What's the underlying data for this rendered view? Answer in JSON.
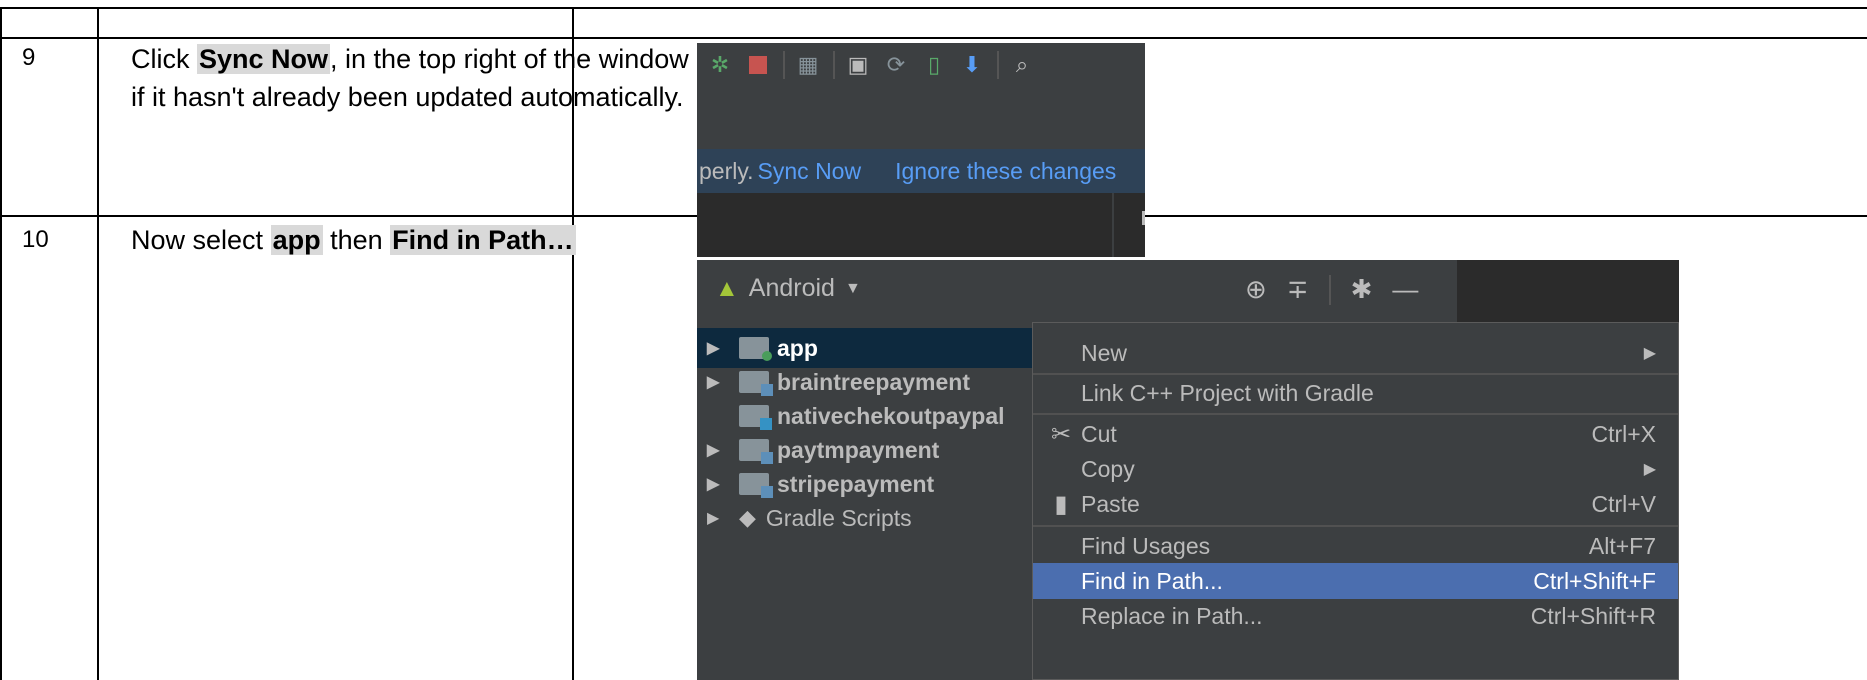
{
  "rows": [
    {
      "step": "9",
      "before": "Click ",
      "highlight": "Sync Now",
      "after": ", in the top right of the window if it hasn't already been updated automatically."
    },
    {
      "step": "10",
      "before": "Now select ",
      "highlight": "app",
      "middle": " then ",
      "highlight2": "Find in Path…"
    }
  ],
  "sync_banner": {
    "prefix": "perly.",
    "sync_now": "Sync Now",
    "ignore": "Ignore these changes"
  },
  "project_panel": {
    "view_label": "Android",
    "tree": [
      {
        "label": "app",
        "selected": true
      },
      {
        "label": "braintreepayment"
      },
      {
        "label": "nativechekoutpaypal"
      },
      {
        "label": "paytmpayment"
      },
      {
        "label": "stripepayment"
      },
      {
        "label": "Gradle Scripts"
      }
    ]
  },
  "context_menu": [
    {
      "label": "New",
      "shortcut": "",
      "submenu": true
    },
    {
      "label": "Link C++ Project with Gradle",
      "shortcut": ""
    },
    {
      "label": "Cut",
      "shortcut": "Ctrl+X",
      "icon": "scissors-icon"
    },
    {
      "label": "Copy",
      "shortcut": "",
      "submenu": true
    },
    {
      "label": "Paste",
      "shortcut": "Ctrl+V",
      "icon": "clipboard-icon"
    },
    {
      "label": "Find Usages",
      "shortcut": "Alt+F7"
    },
    {
      "label": "Find in Path...",
      "shortcut": "Ctrl+Shift+F",
      "highlighted": true
    },
    {
      "label": "Replace in Path...",
      "shortcut": "Ctrl+Shift+R"
    }
  ],
  "colors": {
    "ide_bg": "#3c3f41",
    "banner_bg": "#2e4257",
    "link": "#589df6",
    "menu_highlight": "#4b6eaf",
    "instruction_highlight": "#d9d9d9"
  }
}
